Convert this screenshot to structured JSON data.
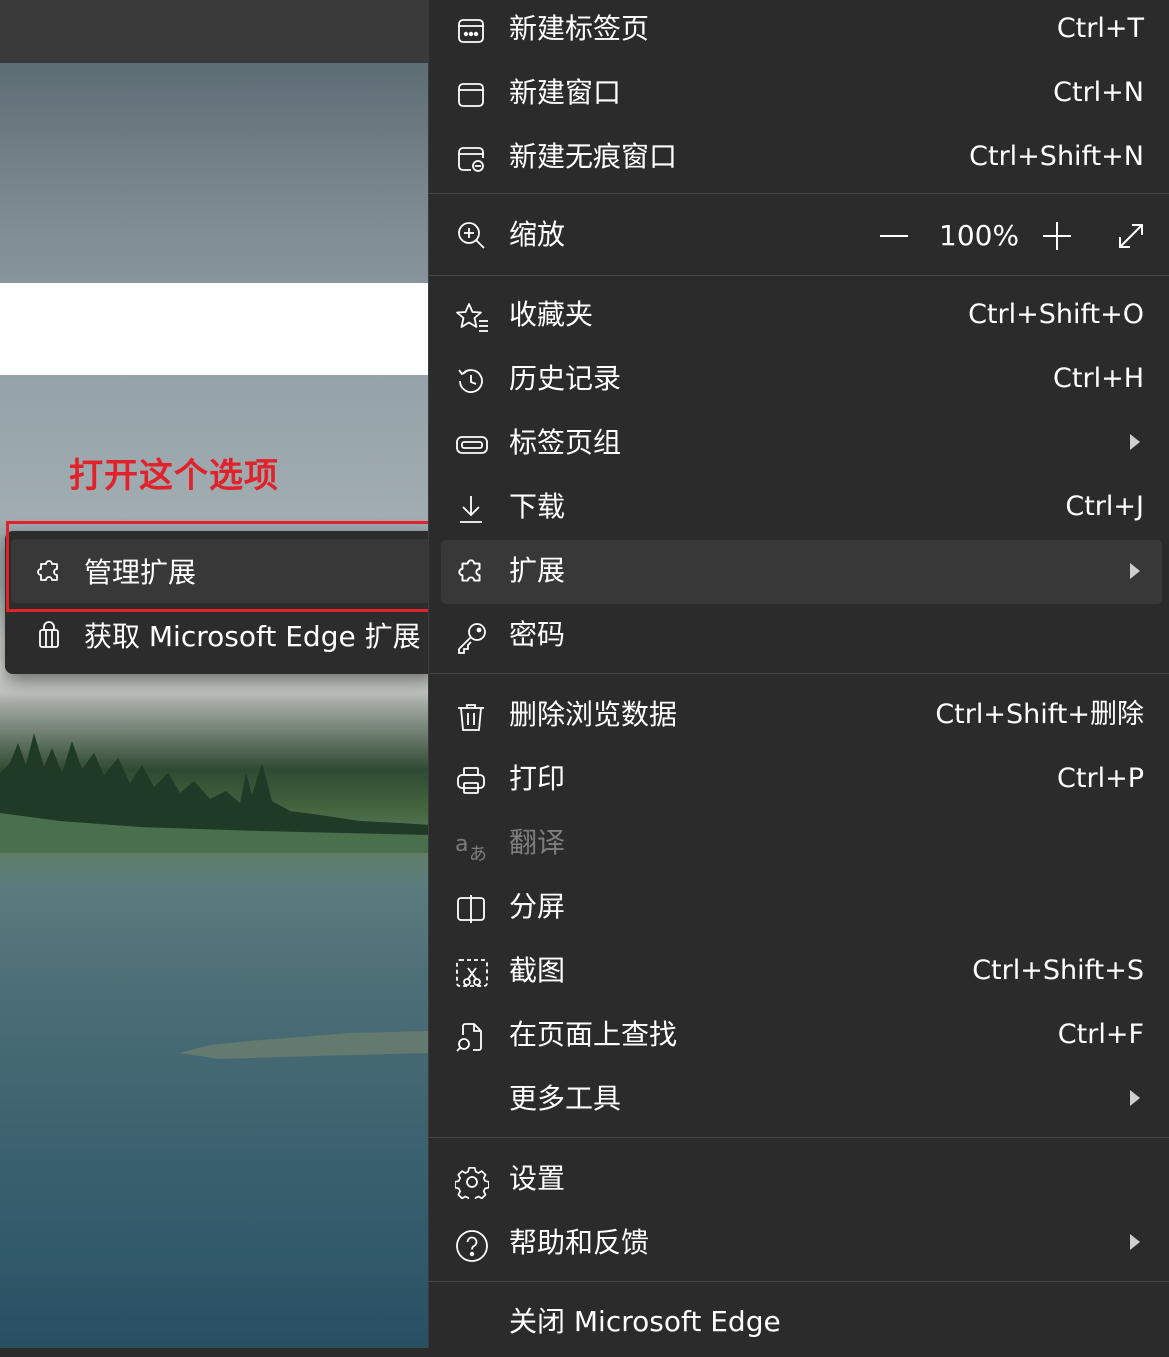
{
  "annotation": {
    "text": "打开这个选项",
    "color": "#e1222b"
  },
  "submenu": {
    "items": [
      {
        "label": "管理扩展",
        "icon": "puzzle-icon"
      },
      {
        "label": "获取 Microsoft Edge 扩展",
        "icon": "shopping-bag-icon"
      }
    ]
  },
  "menu": {
    "new_tab": {
      "label": "新建标签页",
      "shortcut": "Ctrl+T"
    },
    "new_window": {
      "label": "新建窗口",
      "shortcut": "Ctrl+N"
    },
    "new_inprivate": {
      "label": "新建无痕窗口",
      "shortcut": "Ctrl+Shift+N"
    },
    "zoom": {
      "label": "缩放",
      "value": "100%"
    },
    "favorites": {
      "label": "收藏夹",
      "shortcut": "Ctrl+Shift+O"
    },
    "history": {
      "label": "历史记录",
      "shortcut": "Ctrl+H"
    },
    "tab_groups": {
      "label": "标签页组"
    },
    "downloads": {
      "label": "下载",
      "shortcut": "Ctrl+J"
    },
    "extensions": {
      "label": "扩展"
    },
    "passwords": {
      "label": "密码"
    },
    "clear_data": {
      "label": "删除浏览数据",
      "shortcut": "Ctrl+Shift+删除"
    },
    "print": {
      "label": "打印",
      "shortcut": "Ctrl+P"
    },
    "translate": {
      "label": "翻译"
    },
    "split_screen": {
      "label": "分屏"
    },
    "screenshot": {
      "label": "截图",
      "shortcut": "Ctrl+Shift+S"
    },
    "find": {
      "label": "在页面上查找",
      "shortcut": "Ctrl+F"
    },
    "more_tools": {
      "label": "更多工具"
    },
    "settings": {
      "label": "设置"
    },
    "help": {
      "label": "帮助和反馈"
    },
    "close": {
      "label": "关闭 Microsoft Edge"
    }
  },
  "colors": {
    "menu_bg": "#2b2b2b",
    "highlight": "#383838",
    "annotation_red": "#e1222b"
  }
}
